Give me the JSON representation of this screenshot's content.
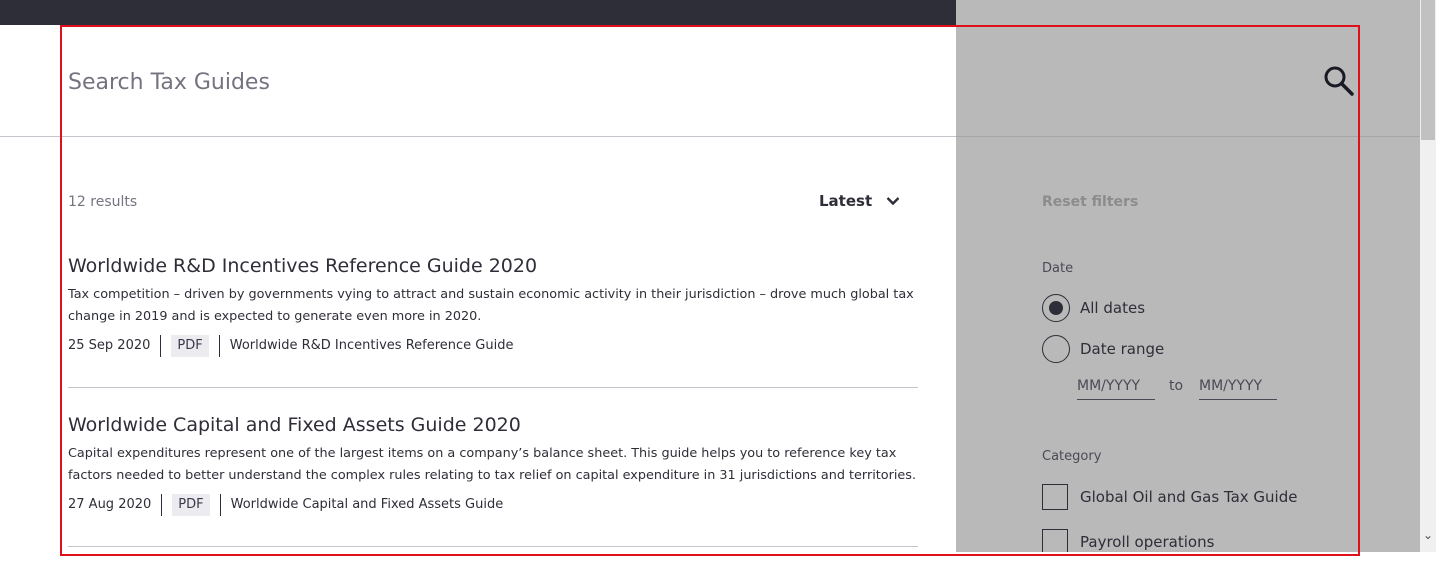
{
  "search": {
    "placeholder": "Search Tax Guides"
  },
  "results": {
    "count_label": "12 results",
    "sort_label": "Latest",
    "items": [
      {
        "title": "Worldwide R&D Incentives Reference Guide 2020",
        "description": "Tax competition – driven by governments vying to attract and sustain economic activity in their jurisdiction – drove much global tax change in 2019 and is expected to generate even more in 2020.",
        "date": "25 Sep 2020",
        "format": "PDF",
        "series": "Worldwide R&D Incentives Reference Guide"
      },
      {
        "title": "Worldwide Capital and Fixed Assets Guide 2020",
        "description": "Capital expenditures represent one of the largest items on a company’s balance sheet. This guide helps you to reference key tax factors needed to better understand the complex rules relating to tax relief on capital expenditure in 31 jurisdictions and territories.",
        "date": "27 Aug 2020",
        "format": "PDF",
        "series": "Worldwide Capital and Fixed Assets Guide"
      }
    ]
  },
  "filters": {
    "reset_label": "Reset filters",
    "date": {
      "label": "Date",
      "options": [
        "All dates",
        "Date range"
      ],
      "selected": "All dates",
      "from_placeholder": "MM/YYYY",
      "to_label": "to",
      "to_placeholder": "MM/YYYY"
    },
    "category": {
      "label": "Category",
      "options": [
        "Global Oil and Gas Tax Guide",
        "Payroll operations"
      ]
    }
  },
  "colors": {
    "topbar": "#2e2e38",
    "side_panel_overlay": "#b9b9b9",
    "highlight_box": "#e0101a"
  }
}
